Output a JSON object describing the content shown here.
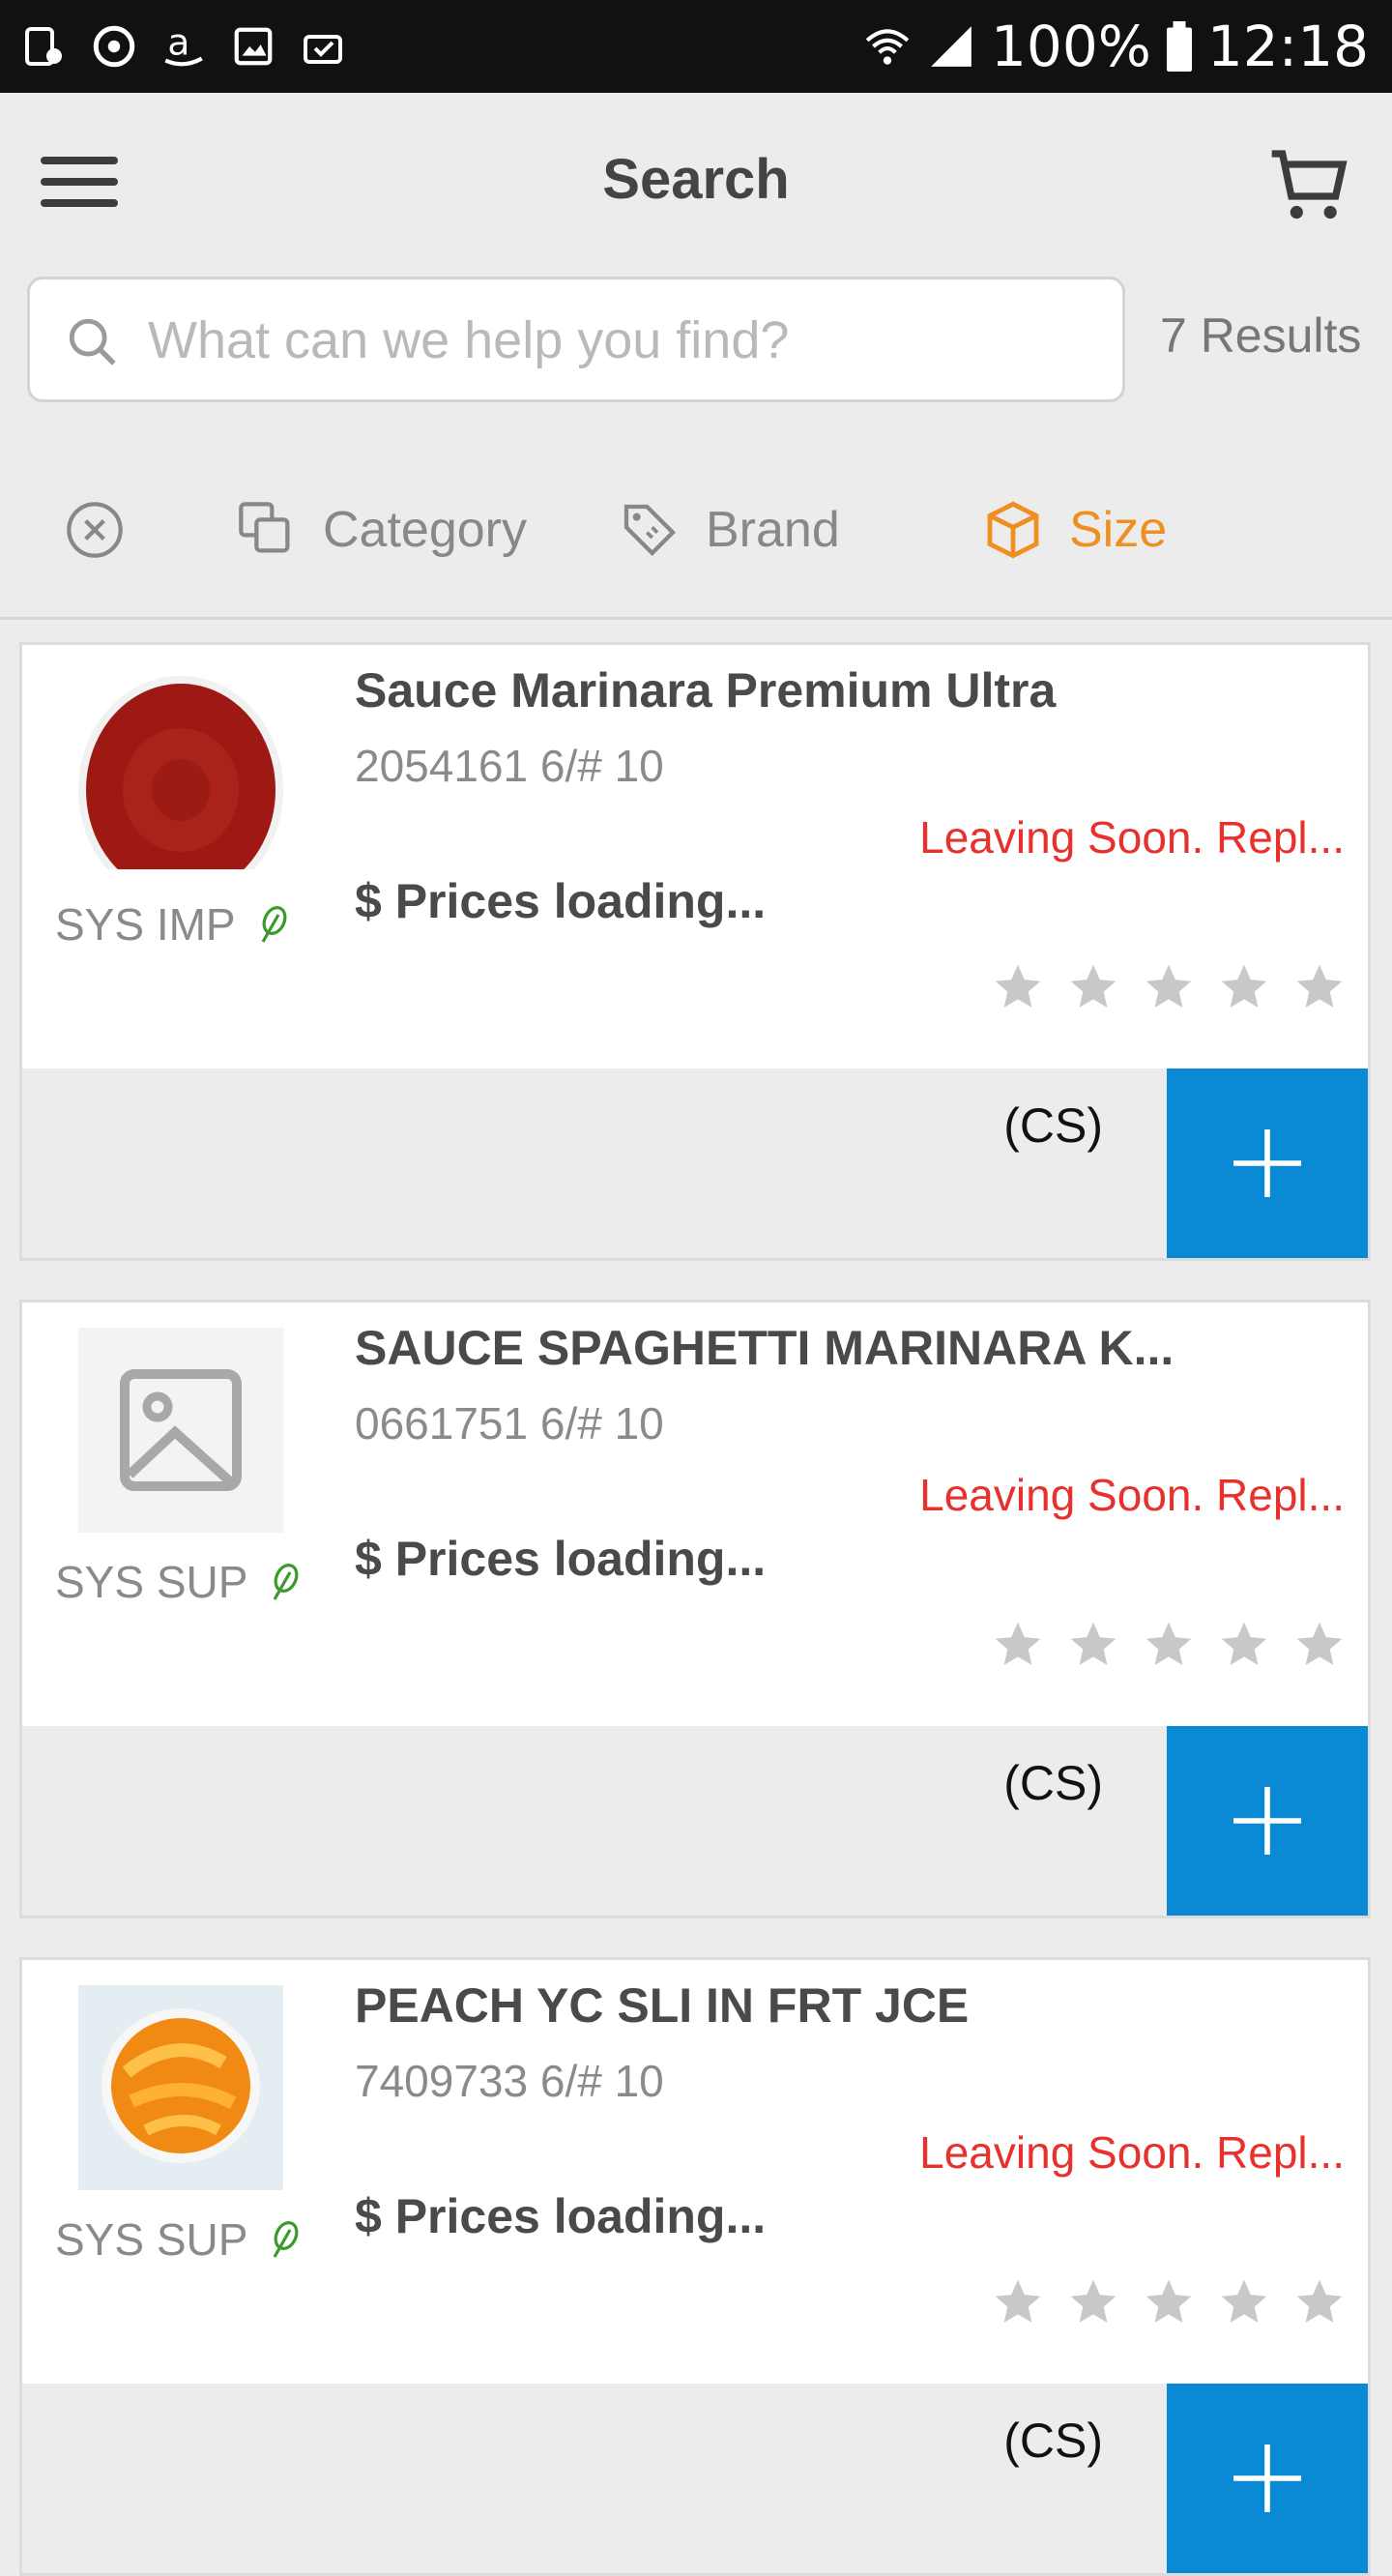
{
  "status_bar": {
    "battery": "100%",
    "time": "12:18",
    "left_icons": [
      "tablet-icon",
      "sync-icon",
      "amazon-icon",
      "image-icon",
      "briefcase-check-icon"
    ]
  },
  "header": {
    "title": "Search",
    "menu_icon": "hamburger-icon",
    "cart_icon": "cart-icon"
  },
  "search": {
    "placeholder": "What can we help you find?",
    "value": "",
    "results_label": "7 Results"
  },
  "filters": [
    {
      "label": "",
      "icon": "clear-filter-icon"
    },
    {
      "label": "Category",
      "icon": "category-icon"
    },
    {
      "label": "Brand",
      "icon": "tag-icon"
    },
    {
      "label": "Size",
      "icon": "box-icon",
      "active": true
    }
  ],
  "colors": {
    "accent": "#ef8f1f",
    "warning": "#e8302c",
    "button": "#0a8ad4",
    "leaf": "#3a9a2a"
  },
  "products": [
    {
      "name": "Sauce Marinara Premium Ultra",
      "number": "2054161 6/# 10",
      "supplier": "SYS IMP",
      "status": "Leaving Soon. Repl...",
      "price": "$ Prices loading...",
      "unit": "(CS)",
      "rating": 0,
      "image": "marinara-image"
    },
    {
      "name": "SAUCE SPAGHETTI MARINARA K...",
      "number": "0661751 6/# 10",
      "supplier": "SYS SUP",
      "status": "Leaving Soon. Repl...",
      "price": "$ Prices loading...",
      "unit": "(CS)",
      "rating": 0,
      "image": "placeholder-image"
    },
    {
      "name": "PEACH YC SLI IN FRT JCE",
      "number": "7409733 6/# 10",
      "supplier": "SYS SUP",
      "status": "Leaving Soon. Repl...",
      "price": "$ Prices loading...",
      "unit": "(CS)",
      "rating": 0,
      "image": "peach-image"
    }
  ]
}
